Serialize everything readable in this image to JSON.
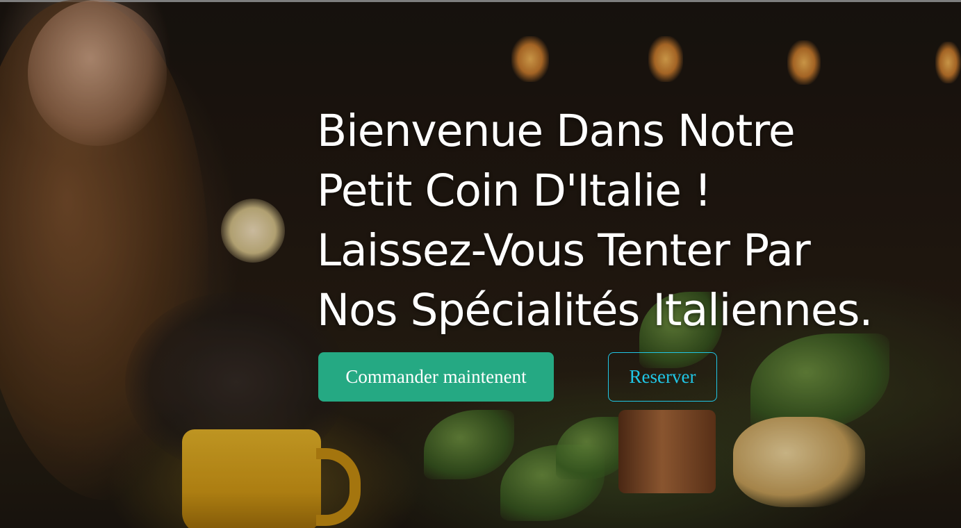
{
  "hero": {
    "headline_lines": [
      "Bienvenue Dans Notre",
      "Petit Coin D'Italie !",
      "Laissez-Vous Tenter Par",
      "Nos Spécialités Italiennes."
    ],
    "order_button_label": "Commander maintenent",
    "reserve_button_label": "Reserver"
  },
  "colors": {
    "primary_button": "#25a983",
    "outline_button": "#20c6e6",
    "headline_text": "#ffffff"
  }
}
